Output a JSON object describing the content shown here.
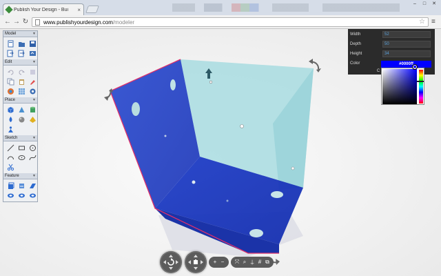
{
  "browser": {
    "tab_title": "Publish Your Design - Bui",
    "tab_close": "×",
    "url_host": "www.publishyourdesign.com",
    "url_path": "/modeler",
    "back_glyph": "←",
    "forward_glyph": "→",
    "reload_glyph": "↻",
    "star_glyph": "☆",
    "menu_glyph": "≡",
    "window_buttons": [
      "–",
      "□",
      "✕"
    ]
  },
  "toolbox": {
    "panels": [
      {
        "title": "Model",
        "tools": [
          "new-file-icon",
          "open-folder-icon",
          "save-icon",
          "import-icon",
          "export-icon",
          "publish-icon"
        ]
      },
      {
        "title": "Edit",
        "tools": [
          "undo-icon",
          "redo-icon",
          "clear-icon",
          "copy-icon",
          "paste-icon",
          "paint-icon",
          "color-wheel-icon",
          "grid-icon",
          "settings-icon"
        ]
      },
      {
        "title": "Place",
        "tools": [
          "cube-icon",
          "cone-icon",
          "cylinder-icon",
          "drop-icon",
          "sphere-icon",
          "pyramid-icon",
          "person-icon"
        ]
      },
      {
        "title": "Sketch",
        "tools": [
          "line-icon",
          "rectangle-icon",
          "circle-icon",
          "arc-icon",
          "ellipse-icon",
          "spline-icon",
          "scissors-icon"
        ]
      },
      {
        "title": "Feature",
        "tools": [
          "extrude-icon",
          "revolve-icon",
          "loft-icon",
          "hole-icon",
          "view-icon",
          "inspect-icon"
        ]
      }
    ]
  },
  "properties": {
    "width_label": "Width",
    "width_value": "52",
    "depth_label": "Depth",
    "depth_value": "50",
    "height_label": "Height",
    "height_value": "34",
    "color_label": "Color",
    "color_value": "#0000ff"
  },
  "bottom_toolbar": {
    "buttons": [
      "zoom-in-icon",
      "zoom-out-icon",
      "fit-icon",
      "search-icon",
      "measure-icon",
      "grid-toggle-icon",
      "layers-icon"
    ],
    "glyphs": [
      "+",
      "−",
      "⤧",
      "⌕",
      "⍊",
      "#",
      "⧉"
    ]
  },
  "colors": {
    "box_front": "#2040c8",
    "box_glass": "#a8dce0",
    "edge_highlight": "#e0306a",
    "panel_bg": "#2b2b2b",
    "selected_color": "#0000ff"
  }
}
